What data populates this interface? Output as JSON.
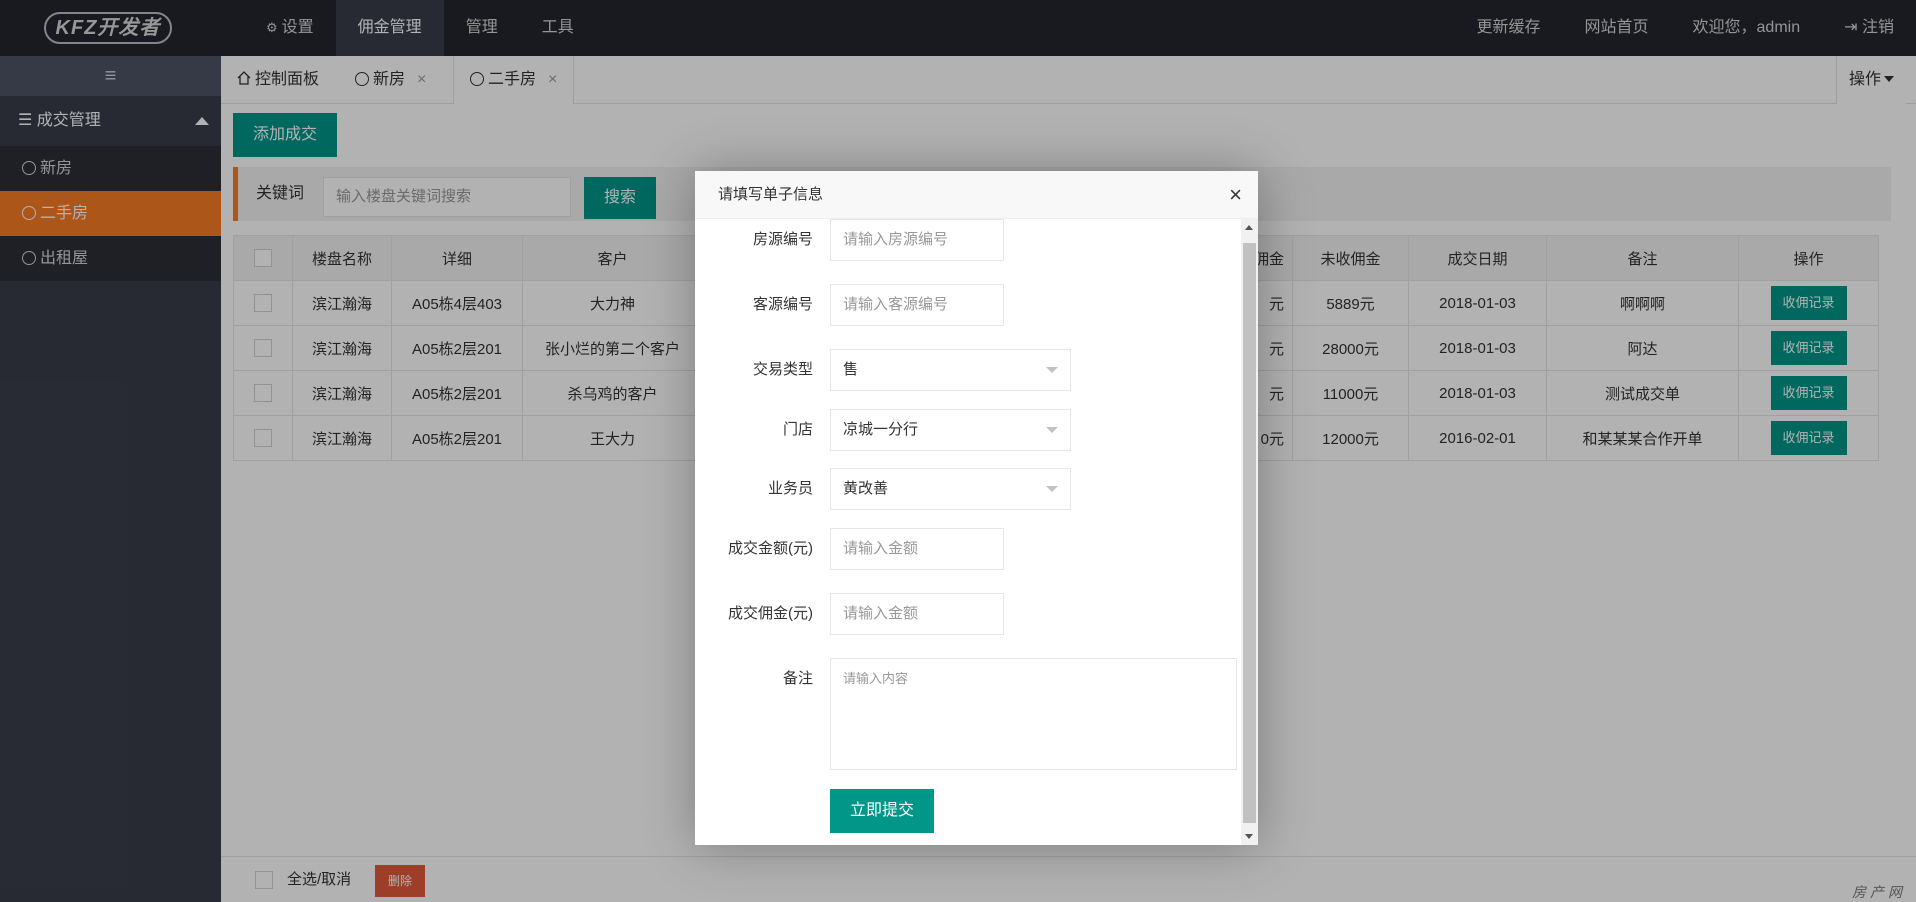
{
  "logo": "KFZ开发者",
  "topnav": [
    {
      "label": "设置",
      "icon": "gears-icon"
    },
    {
      "label": "佣金管理"
    },
    {
      "label": "管理"
    },
    {
      "label": "工具"
    }
  ],
  "topright": {
    "refresh": "更新缓存",
    "home": "网站首页",
    "welcome": "欢迎您，admin",
    "logout": "注销"
  },
  "sidebar": {
    "group": "成交管理",
    "items": [
      "新房",
      "二手房",
      "出租屋"
    ]
  },
  "tabs": {
    "dashboard": "控制面板",
    "tab1": "新房",
    "tab2": "二手房",
    "close": "×",
    "ops": "操作"
  },
  "toolbar": {
    "add": "添加成交",
    "keyword_label": "关键词",
    "search_placeholder": "输入楼盘关键词搜索",
    "search_btn": "搜索"
  },
  "table": {
    "headers": [
      "楼盘名称",
      "详细",
      "客户",
      "佣金",
      "未收佣金",
      "成交日期",
      "备注",
      "操作"
    ],
    "rows": [
      {
        "name": "滨江瀚海",
        "detail": "A05栋4层403",
        "client": "大力神",
        "commission": "元",
        "unpaid": "5889元",
        "date": "2018-01-03",
        "note": "啊啊啊",
        "action": "收佣记录"
      },
      {
        "name": "滨江瀚海",
        "detail": "A05栋2层201",
        "client": "张小烂的第二个客户",
        "commission": "元",
        "unpaid": "28000元",
        "date": "2018-01-03",
        "note": "阿达",
        "action": "收佣记录"
      },
      {
        "name": "滨江瀚海",
        "detail": "A05栋2层201",
        "client": "杀乌鸡的客户",
        "commission": "元",
        "unpaid": "11000元",
        "date": "2018-01-03",
        "note": "测试成交单",
        "action": "收佣记录"
      },
      {
        "name": "滨江瀚海",
        "detail": "A05栋2层201",
        "client": "王大力",
        "commission": "0元",
        "unpaid": "12000元",
        "date": "2016-02-01",
        "note": "和某某某合作开单",
        "action": "收佣记录"
      }
    ]
  },
  "footer": {
    "select_all": "全选/取消",
    "delete": "删除"
  },
  "watermark": "房产网",
  "modal": {
    "title": "请填写单子信息",
    "close": "×",
    "fields": {
      "house_no_label": "房源编号",
      "house_no_placeholder": "请输入房源编号",
      "client_no_label": "客源编号",
      "client_no_placeholder": "请输入客源编号",
      "trade_type_label": "交易类型",
      "trade_type_value": "售",
      "store_label": "门店",
      "store_value": "凉城一分行",
      "agent_label": "业务员",
      "agent_value": "黄改善",
      "amount_label": "成交金额(元)",
      "amount_placeholder": "请输入金额",
      "commission_label": "成交佣金(元)",
      "commission_placeholder": "请输入金额",
      "note_label": "备注",
      "note_placeholder": "请输入内容"
    },
    "submit": "立即提交"
  },
  "colors": {
    "accent_green": "#009688",
    "accent_orange": "#f77b24",
    "header_bg": "#23262e",
    "sidebar_bg": "#393d49"
  }
}
